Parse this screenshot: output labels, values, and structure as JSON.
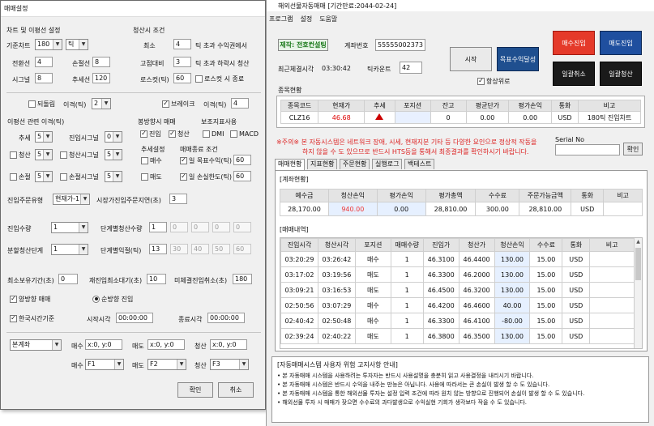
{
  "dialog": {
    "title": "매매설정",
    "chart_section": "차트 및 이평선 설정",
    "clear_section": "청산시 조건",
    "base_chart_label": "기준차트",
    "base_chart_value": "180",
    "base_chart_unit": "틱",
    "transfer_label": "전환선",
    "transfer_value": "4",
    "loss_line_label": "손절선",
    "loss_line_value": "8",
    "signal_label": "시그널",
    "signal_value": "8",
    "trend_label": "추세선",
    "trend_value": "120",
    "cut_label": "최소",
    "cut_value": "4",
    "cut_desc": "틱 초과 수익권에서",
    "fixed_label": "고점대비",
    "fixed_value": "3",
    "fixed_desc": "틱 초과 하락시 청산",
    "losscut_label": "로스컷(틱)",
    "losscut_value": "60",
    "losscut_check": "로스컷 시 종료",
    "rebound_check": "되돌림",
    "rebound_gap_label": "이격(틱)",
    "rebound_gap_value": "2",
    "break_check": "브레이크",
    "break_gap_label": "이격(틱)",
    "break_gap_value": "4",
    "ma_section": "이평선 관련 이격(틱)",
    "trend_ma_label": "추세",
    "trend_ma_value": "5",
    "entry_signal_label": "진입시그널",
    "entry_signal_value": "0",
    "clear_ma_check": "청산",
    "clear_ma_value": "5",
    "clear_signal_check": "청산시그널",
    "clear_signal_value": "5",
    "stop_ma_check": "손절",
    "stop_ma_value": "5",
    "stop_signal_check": "손절시그널",
    "stop_signal_value": "5",
    "direction_section": "봉방향시 매매",
    "entry_check": "진입",
    "clear_check": "청산",
    "aux_section": "보조지표사용",
    "dmi_check": "DMI",
    "macd_check": "MACD",
    "trend_setting_section": "추세설정",
    "buy_check": "매수",
    "sell_check": "매도",
    "exit_section": "매매종료 조건",
    "target_profit_check": "일 목표수익(틱)",
    "target_profit_value": "60",
    "daily_loss_check": "일 손실한도(틱)",
    "daily_loss_value": "60",
    "order_type_label": "진입주문유형",
    "order_type_value": "현재가-1",
    "market_delay_label": "시장가진입주문지연(초)",
    "market_delay_value": "3",
    "entry_qty_label": "진입수량",
    "entry_qty_value": "1",
    "step_entry_label": "단계별청산수량",
    "step_entry_values": [
      "1",
      "0",
      "0",
      "0",
      "0"
    ],
    "split_label": "분할청산단계",
    "split_value": "1",
    "step_gap_label": "단계별익절(틱)",
    "step_gap_values": [
      "13",
      "30",
      "40",
      "50",
      "60"
    ],
    "min_hold_label": "최소보유기간(초)",
    "min_hold_value": "0",
    "reentry_label": "재진입최소대기(초)",
    "reentry_value": "10",
    "unfilled_label": "미체결진입취소(초)",
    "unfilled_value": "180",
    "bidirectional_check": "양방향 매매",
    "oneway_radio": "순방향 진입",
    "korea_time_check": "한국시간기준",
    "start_time_label": "시작시각",
    "start_time_value": "00:00:00",
    "end_time_label": "종료시각",
    "end_time_value": "00:00:00",
    "mode_select": "본계좌",
    "buy_coord_label": "매수",
    "buy_coord_value": "x:0, y:0",
    "sell_coord_label": "매도",
    "sell_coord_value": "x:0, y:0",
    "clear_coord_label": "청산",
    "clear_coord_value": "x:0, y:0",
    "key_buy_label": "매수",
    "key_buy_value": "F1",
    "key_sell_label": "매도",
    "key_sell_value": "F2",
    "key_clear_label": "청산",
    "key_clear_value": "F3",
    "ok_button": "확인",
    "cancel_button": "취소"
  },
  "main": {
    "title": "해외선물자동매매 [기간만료:2044-02-24]",
    "menu": [
      "프로그램",
      "설정",
      "도움말"
    ],
    "product_tag": "제작: 전호컨설팅",
    "account_label": "계좌번호",
    "account_value": "55555002373",
    "last_exec_label": "최근체결시각",
    "last_exec_value": "03:30:42",
    "tick_count_label": "틱카운트",
    "tick_count_value": "42",
    "start_button": "시작",
    "target_button": "목표수익달성",
    "always_top_check": "항상위로",
    "buy_entry_button": "매수진입",
    "sell_entry_button": "매도진입",
    "batch_cancel_button": "일괄취소",
    "batch_clear_button": "일괄청산",
    "stock_section": "종목현황",
    "stock_headers": [
      "종목코드",
      "현재가",
      "추세",
      "포지션",
      "잔고",
      "평균단가",
      "평가손익",
      "통화",
      "비고"
    ],
    "stock_row": [
      "CLZ16",
      "46.68",
      "",
      "",
      "0",
      "0.00",
      "0.00",
      "USD",
      "180틱 진입차트"
    ],
    "warning_line1": "※주의※ 본 자동시스템은 네트워크 장애, 시세, 현재지분 기타 등 다양한 요인으로 정상적 작동을",
    "warning_line2": "하지 않을 수 도 있으므로 반드시 HTS등을 통해서 최종결과를 확인하시기 바랍니다.",
    "serial_label": "Serial No",
    "confirm_button": "확인",
    "tabs": [
      "매매현황",
      "지표현황",
      "주문현황",
      "실행로그",
      "백테스트"
    ],
    "account_section": "[계좌현황]",
    "account_headers": [
      "예수금",
      "청산손익",
      "평가손익",
      "평가총액",
      "수수료",
      "주문가능금액",
      "통화",
      "비고"
    ],
    "account_row": [
      "28,170.00",
      "940.00",
      "0.00",
      "28,810.00",
      "300.00",
      "28,810.00",
      "USD",
      ""
    ],
    "trade_section": "[매매내역]",
    "trade_headers": [
      "진입시각",
      "청산시각",
      "포지션",
      "매매수량",
      "진입가",
      "청산가",
      "청산손익",
      "수수료",
      "통화",
      "비고"
    ],
    "trade_rows": [
      [
        "03:20:29",
        "03:26:42",
        "매수",
        "1",
        "46.3100",
        "46.4400",
        "130.00",
        "15.00",
        "USD",
        ""
      ],
      [
        "03:17:02",
        "03:19:56",
        "매도",
        "1",
        "46.3300",
        "46.2000",
        "130.00",
        "15.00",
        "USD",
        ""
      ],
      [
        "03:09:21",
        "03:16:53",
        "매도",
        "1",
        "46.4500",
        "46.3200",
        "130.00",
        "15.00",
        "USD",
        ""
      ],
      [
        "02:50:56",
        "03:07:29",
        "매수",
        "1",
        "46.4200",
        "46.4600",
        "40.00",
        "15.00",
        "USD",
        ""
      ],
      [
        "02:40:42",
        "02:50:48",
        "매수",
        "1",
        "46.3300",
        "46.4100",
        "-80.00",
        "15.00",
        "USD",
        ""
      ],
      [
        "02:39:24",
        "02:40:22",
        "매도",
        "1",
        "46.3800",
        "46.3500",
        "130.00",
        "15.00",
        "USD",
        ""
      ]
    ],
    "notice_title": "[자동매매시스템 사용자 위험 고지사항 안내]",
    "notice_lines": [
      "• 본 자동매매 시스템을 사용하려는 투자자는 반드시 사용설명을 충분히 읽고 사용결정을 내리시기 바랍니다.",
      "• 본 자동매매 시스템은 반드시 수익을 내주는 만능은 아닙니다. 사용에 따라서는 큰 손실이 발생 할 수 도 있습니다.",
      "• 본 자동매매 시스템을 통한 해외선물 투자는 설정 입력 조건에 따라 원치 않는 방향으로 진행되어 손실이 발생 할 수 도 있습니다.",
      "• 해외선물 투자 시 매매가 잦으면 수수료의 과다발생으로 수익실현 기회가 생각보다 작을 수 도 있습니다."
    ]
  }
}
